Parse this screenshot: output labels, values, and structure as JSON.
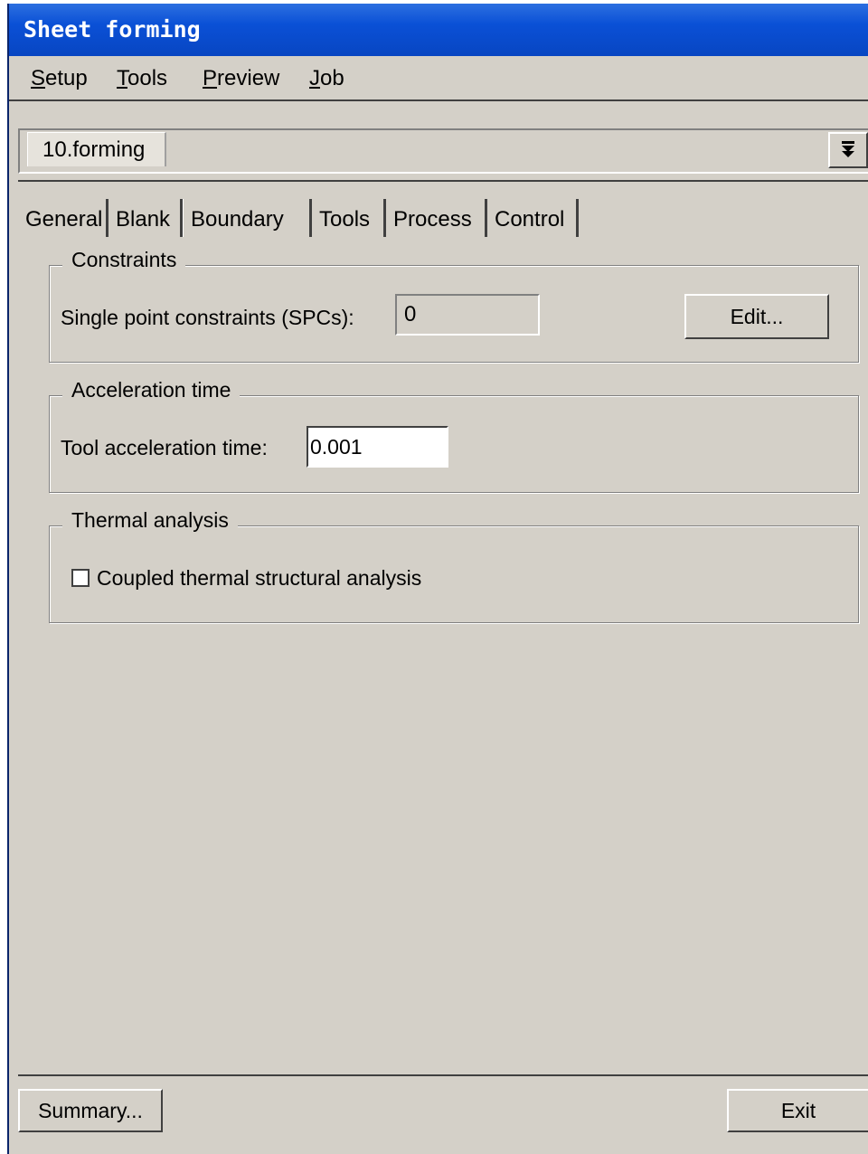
{
  "window": {
    "title": "Sheet forming"
  },
  "menubar": {
    "items": [
      {
        "mnemonic": "S",
        "rest": "etup"
      },
      {
        "mnemonic": "T",
        "rest": "ools"
      },
      {
        "mnemonic": "P",
        "rest": "review"
      },
      {
        "mnemonic": "J",
        "rest": "ob"
      }
    ]
  },
  "stage_selector": {
    "value": "10.forming",
    "button_icon": "double-chevron-down-icon"
  },
  "tabs": {
    "items": [
      "General",
      "Blank",
      "Boundary",
      "Tools",
      "Process",
      "Control"
    ],
    "active": "Boundary"
  },
  "constraints": {
    "title": "Constraints",
    "spc_label": "Single point constraints (SPCs):",
    "spc_value": "0",
    "edit_label": "Edit..."
  },
  "acceleration": {
    "title": "Acceleration time",
    "tool_label": "Tool acceleration time:",
    "tool_value": "0.001"
  },
  "thermal": {
    "title": "Thermal analysis",
    "coupled_label": "Coupled thermal structural analysis",
    "coupled_checked": false
  },
  "footer": {
    "summary_label": "Summary...",
    "exit_label": "Exit"
  }
}
